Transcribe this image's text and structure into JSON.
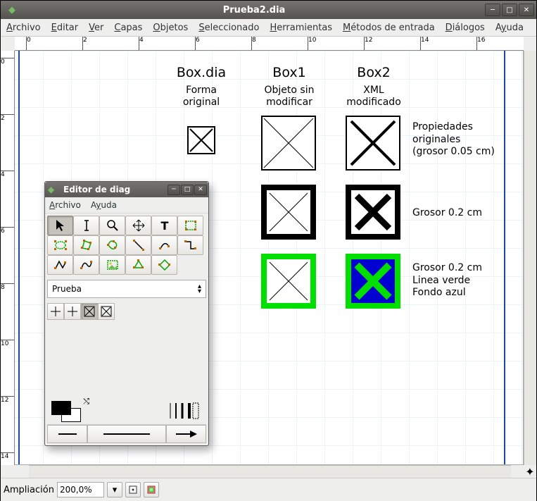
{
  "window": {
    "title": "Prueba2.dia"
  },
  "menu": {
    "archivo": "Archivo",
    "editar": "Editar",
    "ver": "Ver",
    "capas": "Capas",
    "objetos": "Objetos",
    "seleccionado": "Seleccionado",
    "herramientas": "Herramientas",
    "metodos": "Métodos de entrada",
    "dialogos": "Diálogos",
    "ayuda": "Ayuda"
  },
  "ruler_h": [
    0,
    2,
    4,
    6,
    8,
    10,
    12,
    14,
    16
  ],
  "ruler_v": [
    0,
    2,
    4,
    6,
    8,
    10,
    12,
    14
  ],
  "diagram": {
    "col1_head": "Box.dia",
    "col1_sub": "Forma\noriginal",
    "col2_head": "Box1",
    "col2_sub": "Objeto sin\nmodificar",
    "col3_head": "Box2",
    "col3_sub": "XML\nmodificado",
    "row1": "Propiedades\noriginales\n(grosor 0.05 cm)",
    "row2": "Grosor 0.2 cm",
    "row3": "Grosor 0.2 cm\nLinea verde\nFondo azul"
  },
  "status": {
    "label": "Ampliación",
    "zoom": "200,0%"
  },
  "toolbox": {
    "title": "Editor de diag",
    "menu_archivo": "Archivo",
    "menu_ayuda": "Ayuda",
    "sheet": "Prueba",
    "tools": [
      "pointer",
      "text-cursor",
      "magnify",
      "move",
      "text",
      "rect",
      "poly-green",
      "poly-orange",
      "poly-green2",
      "line",
      "bezier",
      "orth",
      "curve1",
      "curve2",
      "img",
      "arrow-green",
      "arrow-green2"
    ]
  }
}
